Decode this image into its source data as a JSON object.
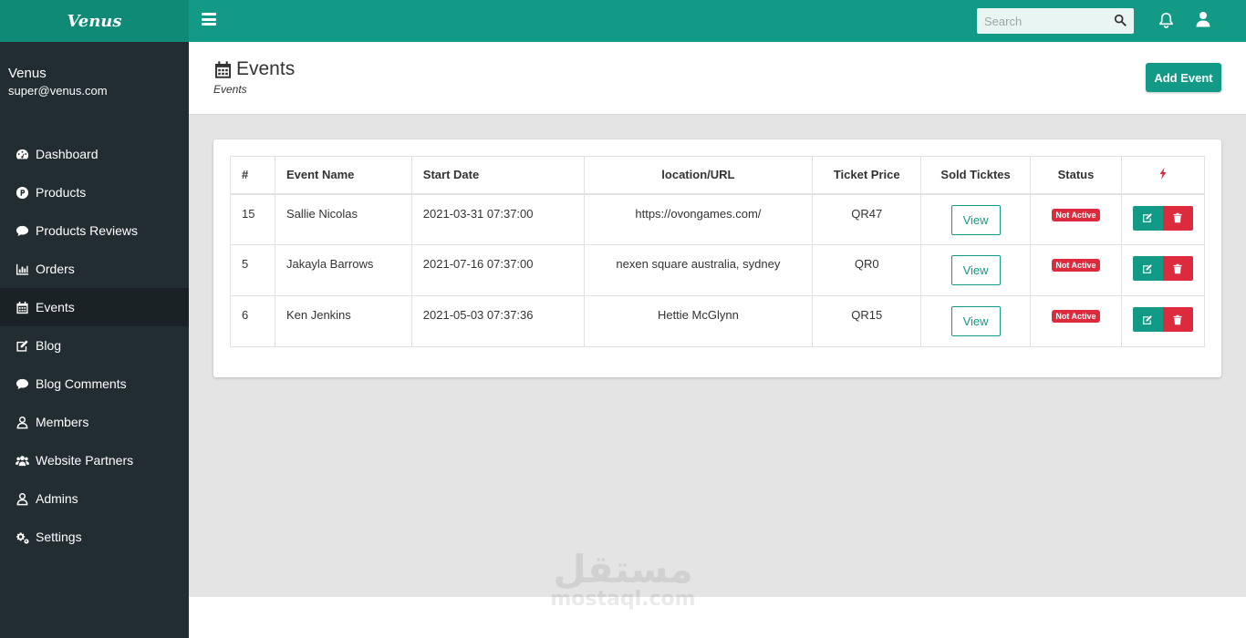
{
  "app": {
    "brand": "Venus"
  },
  "search": {
    "placeholder": "Search"
  },
  "user": {
    "name": "Venus",
    "email": "super@venus.com"
  },
  "sidebar": {
    "items": [
      {
        "label": "Dashboard",
        "icon": "dashboard-icon"
      },
      {
        "label": "Products",
        "icon": "product-icon"
      },
      {
        "label": "Products Reviews",
        "icon": "comment-icon"
      },
      {
        "label": "Orders",
        "icon": "chart-icon"
      },
      {
        "label": "Events",
        "icon": "calendar-icon",
        "active": true
      },
      {
        "label": "Blog",
        "icon": "edit-icon"
      },
      {
        "label": "Blog Comments",
        "icon": "comment-icon"
      },
      {
        "label": "Members",
        "icon": "user-icon"
      },
      {
        "label": "Website Partners",
        "icon": "users-icon"
      },
      {
        "label": "Admins",
        "icon": "user-icon"
      },
      {
        "label": "Settings",
        "icon": "gears-icon"
      }
    ]
  },
  "page": {
    "title": "Events",
    "breadcrumb": "Events",
    "add_button": "Add Event"
  },
  "table": {
    "headers": [
      "#",
      "Event Name",
      "Start Date",
      "location/URL",
      "Ticket Price",
      "Sold Ticktes",
      "Status"
    ],
    "rows": [
      {
        "id": "15",
        "name": "Sallie Nicolas",
        "start": "2021-03-31 07:37:00",
        "location": "https://ovongames.com/",
        "price": "QR47",
        "sold": "View",
        "status": "Not Active"
      },
      {
        "id": "5",
        "name": "Jakayla Barrows",
        "start": "2021-07-16 07:37:00",
        "location": "nexen square australia, sydney",
        "price": "QR0",
        "sold": "View",
        "status": "Not Active"
      },
      {
        "id": "6",
        "name": "Ken Jenkins",
        "start": "2021-05-03 07:37:36",
        "location": "Hettie McGlynn",
        "price": "QR15",
        "sold": "View",
        "status": "Not Active"
      }
    ]
  },
  "watermark": {
    "arabic": "مستقل",
    "latin": "mostaql.com"
  },
  "colors": {
    "primary": "#139a86",
    "danger": "#dd2a3c",
    "sidebar": "#222d32"
  }
}
